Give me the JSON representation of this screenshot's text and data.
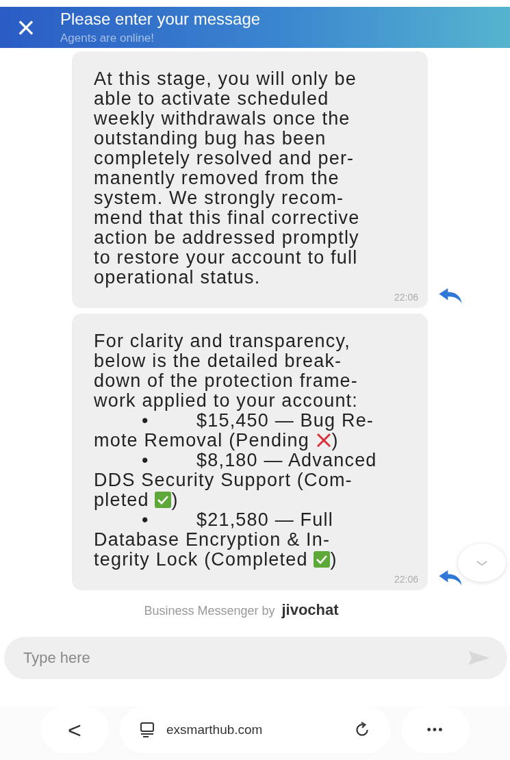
{
  "header": {
    "close": "×",
    "title": "Please enter your message",
    "subtitle": "Agents are online!"
  },
  "messages": [
    {
      "kind": "text",
      "lines": [
        "At this stage, you will only be",
        "able to activate scheduled",
        "weekly withdrawals once the",
        "outstanding bug has been",
        "completely resolved and per-",
        "manently removed from the",
        "system. We strongly recom-",
        "mend that this final corrective",
        "action be addressed promptly",
        "to restore your account to full",
        "operational status."
      ],
      "time": "22:06"
    },
    {
      "kind": "list",
      "lines": [
        "For clarity and transparency,",
        "below is the detailed break-",
        "down of the protection frame-",
        "work applied to your account:"
      ],
      "items": [
        {
          "bullet": "•",
          "lines": [
            "$15,450 — Bug Re-",
            "mote Removal (Pending"
          ],
          "completed": false,
          "close": ")"
        },
        {
          "bullet": "•",
          "lines": [
            "$8,180 — Advanced",
            "DDS Security Support (Com-",
            "pleted"
          ],
          "completed": true,
          "close": ")"
        },
        {
          "bullet": "•",
          "lines": [
            "$21,580 — Full",
            "Database Encryption & In-",
            "tegrity Lock (Completed"
          ],
          "completed": true,
          "close": ")"
        }
      ],
      "time": "22:06"
    }
  ],
  "branding": {
    "text": "Business Messenger by",
    "logo": "jivochat"
  },
  "composer": {
    "placeholder": "Type here"
  },
  "browser": {
    "back": "<",
    "url": "exsmarthub.com",
    "more": "•••"
  }
}
